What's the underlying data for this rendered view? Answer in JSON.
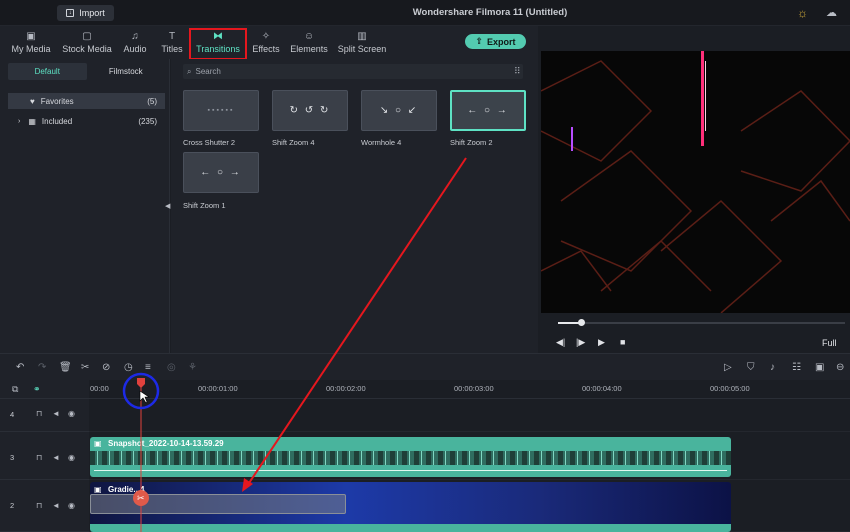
{
  "app": {
    "title": "Wondershare Filmora 11 (Untitled)",
    "import_label": "Import"
  },
  "tabs": [
    {
      "label": "My Media",
      "icon": "media-folder-icon",
      "glyph": "▣"
    },
    {
      "label": "Stock Media",
      "icon": "stock-media-icon",
      "glyph": "▢"
    },
    {
      "label": "Audio",
      "icon": "audio-note-icon",
      "glyph": "♫"
    },
    {
      "label": "Titles",
      "icon": "titles-icon",
      "glyph": "T"
    },
    {
      "label": "Transitions",
      "icon": "transitions-icon",
      "glyph": "⧓",
      "active": true
    },
    {
      "label": "Effects",
      "icon": "effects-sparkle-icon",
      "glyph": "✧"
    },
    {
      "label": "Elements",
      "icon": "elements-icon",
      "glyph": "☺"
    },
    {
      "label": "Split Screen",
      "icon": "split-screen-icon",
      "glyph": "▥"
    }
  ],
  "export_label": "Export",
  "library": {
    "segments": [
      "Default",
      "Filmstock"
    ],
    "categories": [
      {
        "label": "Favorites",
        "count": "(5)",
        "icon": "heart-icon"
      },
      {
        "label": "Included",
        "count": "(235)",
        "icon": "grid-icon"
      }
    ]
  },
  "search": {
    "placeholder": "Search"
  },
  "transitions": [
    {
      "label": "Cross Shutter 2",
      "glyph": "▪▪▪▪▪▪",
      "selected": false
    },
    {
      "label": "Shift Zoom 4",
      "glyph": "↻ ↺ ↻",
      "selected": false
    },
    {
      "label": "Wormhole 4",
      "glyph": "↘ ○ ↙",
      "selected": false
    },
    {
      "label": "Shift Zoom 2",
      "glyph": "← ○ →",
      "selected": true
    },
    {
      "label": "Shift Zoom 1",
      "glyph": "← ○ →",
      "selected": false
    }
  ],
  "player": {
    "progress": 0.08,
    "quality": "Full"
  },
  "timeline": {
    "ruler": [
      "00:00",
      "00:00:01:00",
      "00:00:02:00",
      "00:00:03:00",
      "00:00:04:00",
      "00:00:05:00"
    ],
    "tracks": [
      {
        "num": "4",
        "clip": ""
      },
      {
        "num": "3",
        "clip": "Snapshot_2022-10-14-13.59.29"
      },
      {
        "num": "2",
        "clip": "Gradie...4"
      }
    ]
  },
  "colors": {
    "accent": "#5ee2c4",
    "highlight": "#e5171e",
    "playhead": "#e0413d"
  }
}
